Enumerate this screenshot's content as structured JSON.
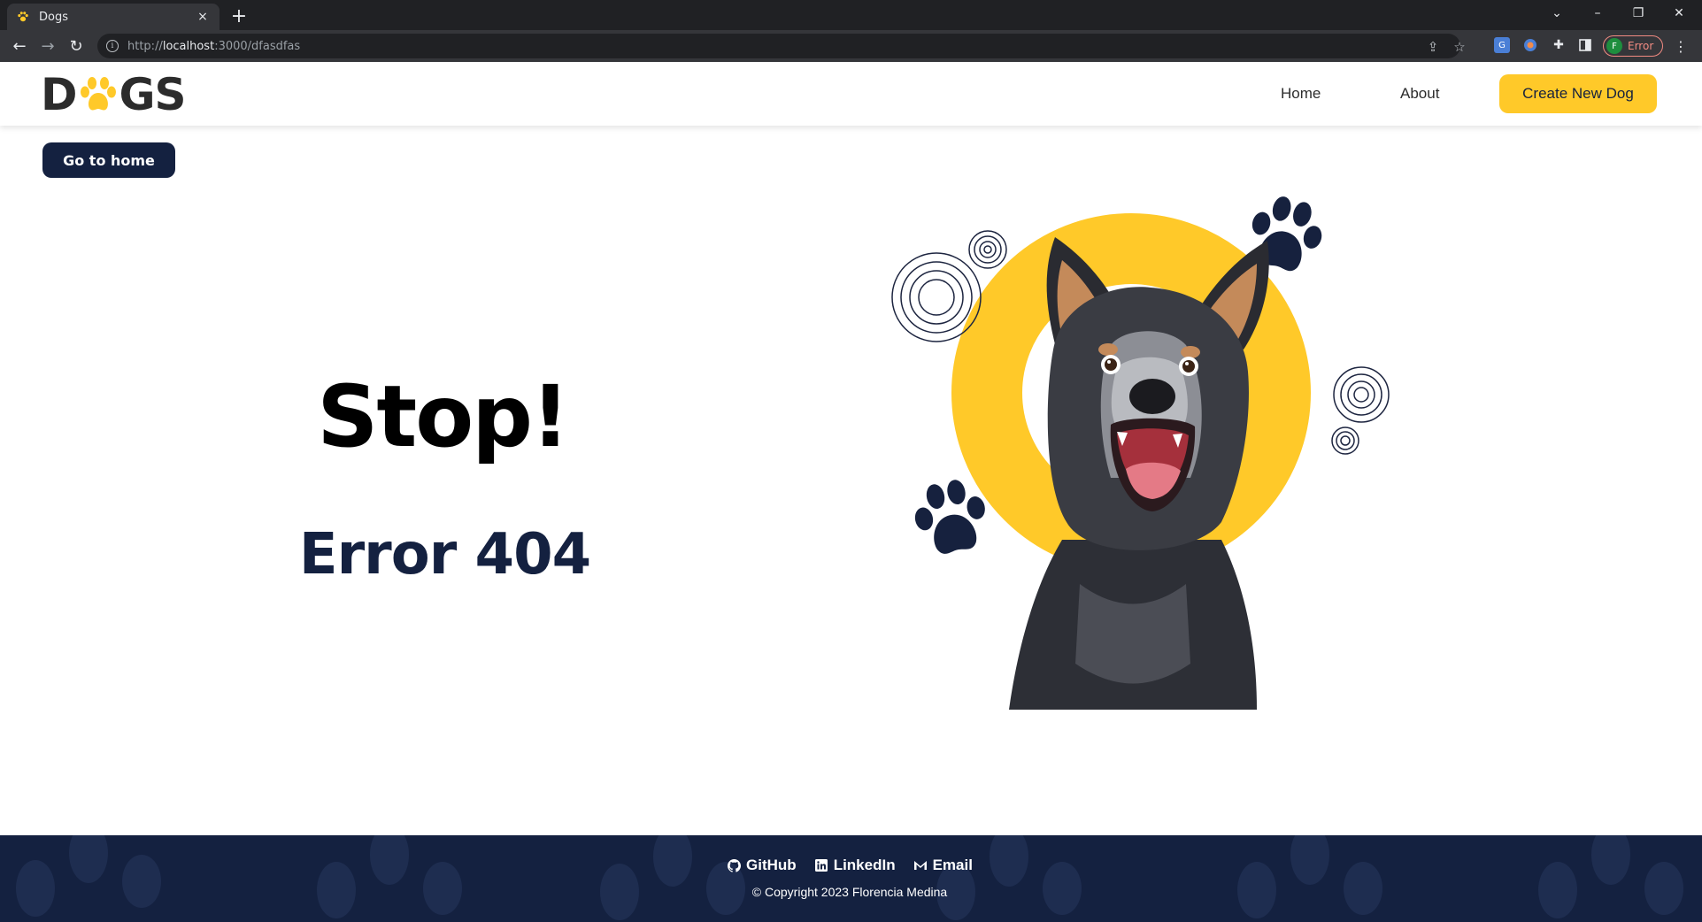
{
  "browser": {
    "tab_title": "Dogs",
    "tab_close": "×",
    "new_tab": "+",
    "url_scheme": "http://",
    "url_host": "localhost",
    "url_rest": ":3000/dfasdfas",
    "profile_initial": "F",
    "profile_status": "Error"
  },
  "header": {
    "logo_left": "D",
    "logo_right": "GS",
    "nav": {
      "home": "Home",
      "about": "About"
    },
    "create_label": "Create New Dog"
  },
  "main": {
    "home_button": "Go to home",
    "headline": "Stop!",
    "error_text": "Error 404"
  },
  "footer": {
    "links": {
      "github": "GitHub",
      "linkedin": "LinkedIn",
      "email": "Email"
    },
    "copyright": "© Copyright 2023 Florencia Medina"
  },
  "colors": {
    "accent_yellow": "#ffc929",
    "navy": "#142140",
    "text_dark": "#2c2c2c"
  },
  "icons": [
    "paw-icon",
    "close-icon",
    "plus-icon",
    "back-icon",
    "forward-icon",
    "reload-icon",
    "info-icon",
    "share-icon",
    "star-icon",
    "translate-icon",
    "extension-icon",
    "puzzle-icon",
    "sidepanel-icon",
    "menu-icon",
    "github-icon",
    "linkedin-icon",
    "email-icon"
  ]
}
